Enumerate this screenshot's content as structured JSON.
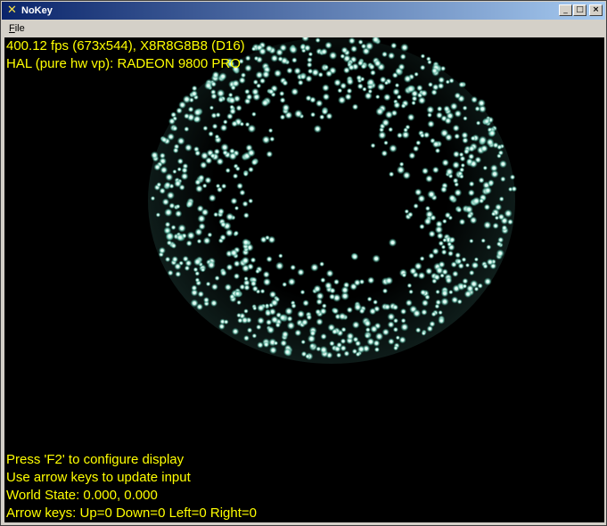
{
  "window": {
    "title": "NoKey",
    "icon": "x-icon"
  },
  "menu": {
    "file_label": "File"
  },
  "hud": {
    "stats": "400.12 fps (673x544), X8R8G8B8 (D16)",
    "device": "HAL (pure hw vp): RADEON 9800 PRO",
    "help_display": "Press 'F2' to configure display",
    "help_input": "Use arrow keys to update input",
    "world_state": "World State: 0.000, 0.000",
    "arrow_keys": "Arrow keys: Up=0 Down=0 Left=0 Right=0"
  },
  "colors": {
    "hud_text": "#ffff00",
    "particle": "#bff5e6",
    "background": "#000000"
  }
}
